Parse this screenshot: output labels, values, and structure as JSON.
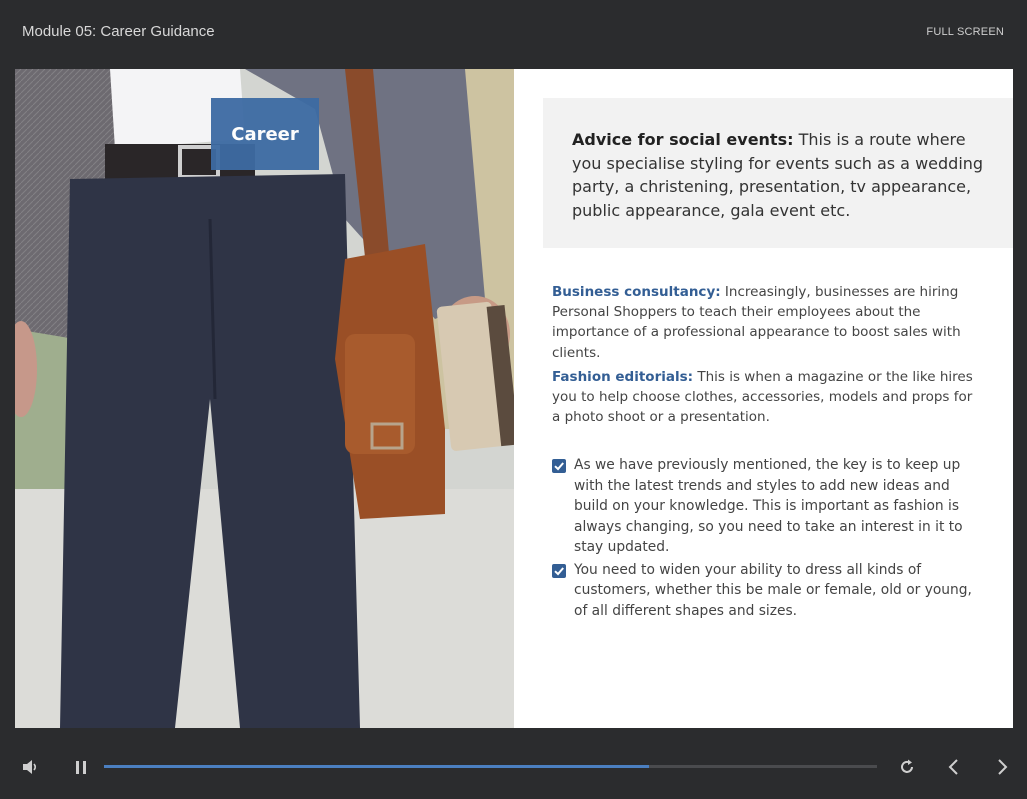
{
  "header": {
    "module_title": "Module 05: Career Guidance",
    "fullscreen_label": "FULL SCREEN"
  },
  "slide": {
    "image_tag": "Career",
    "callout": {
      "lead": "Advice for social events:",
      "text": " This is a route where you specialise styling for events such as a wedding party, a christening, presentation, tv appearance, public appearance, gala event etc."
    },
    "paragraphs": [
      {
        "label": "Business consultancy:",
        "text": " Increasingly, businesses are hiring Personal Shoppers to teach their employees about the importance of a professional appearance to boost sales with clients."
      },
      {
        "label": "Fashion editorials:",
        "text": " This is when a magazine or the like hires you to help choose clothes, accessories, models and props for a photo shoot or a presentation."
      }
    ],
    "checklist": [
      {
        "text": "As we have previously mentioned, the key is to keep up with the latest trends and styles to add new ideas and build on your knowledge. This is important as fashion is always changing, so you need to take an interest in it to stay updated.",
        "checked": true
      },
      {
        "text": "You need to widen your ability to dress all kinds of customers, whether this be male or female, old or young, of all different shapes and sizes.",
        "checked": true
      }
    ]
  },
  "player": {
    "progress_fraction": 0.705,
    "icons": [
      "volume-icon",
      "pause-icon",
      "replay-icon",
      "previous-icon",
      "next-icon"
    ]
  },
  "colors": {
    "background": "#2b2c2e",
    "accent": "#335e94",
    "progress": "#4b7fc0",
    "callout_bg": "#f2f2f2"
  }
}
